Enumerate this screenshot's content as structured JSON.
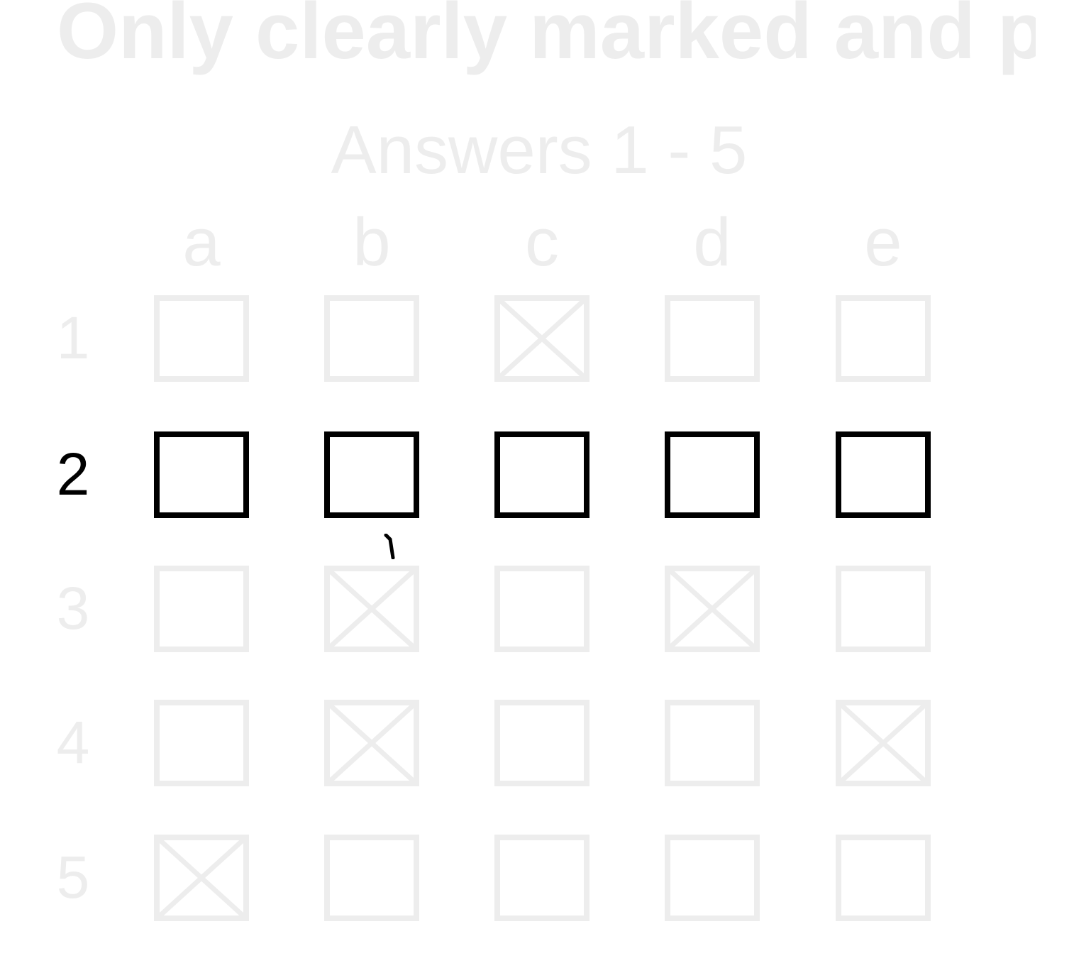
{
  "header": {
    "small_label": "",
    "instruction": "Only clearly marked and po",
    "title": "Answers 1 - 5"
  },
  "grid": {
    "columns": [
      "a",
      "b",
      "c",
      "d",
      "e"
    ],
    "rows": [
      {
        "number": "1",
        "marked": [
          "c"
        ]
      },
      {
        "number": "2",
        "marked": []
      },
      {
        "number": "3",
        "marked": [
          "b",
          "d"
        ]
      },
      {
        "number": "4",
        "marked": [
          "b",
          "e"
        ]
      },
      {
        "number": "5",
        "marked": [
          "a"
        ]
      }
    ],
    "active_row": "2"
  },
  "colors": {
    "ink": "#000000",
    "faded": "#ededed",
    "background": "#ffffff"
  }
}
